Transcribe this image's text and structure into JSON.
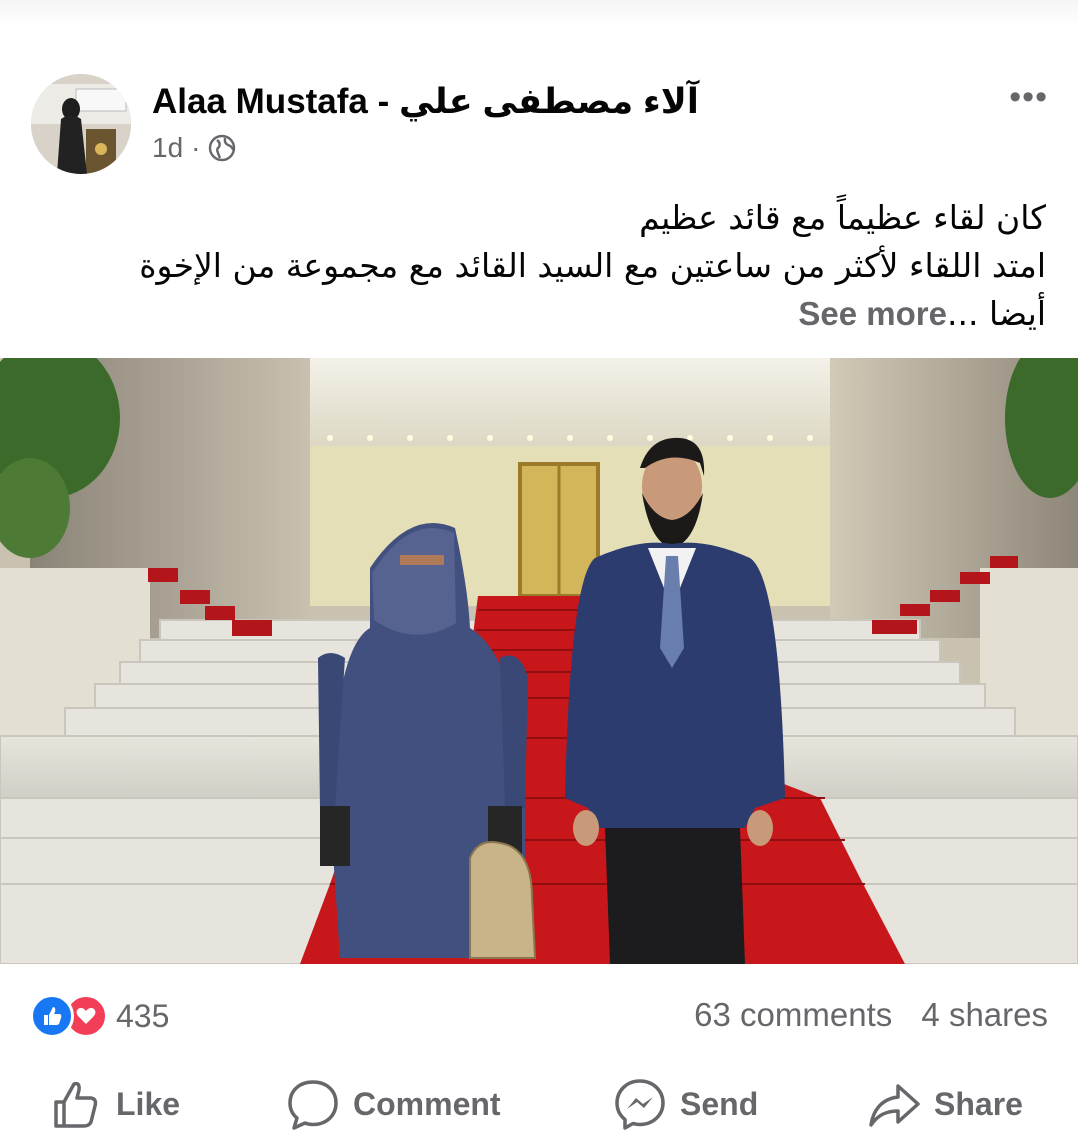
{
  "post": {
    "author": "Alaa Mustafa - آلاء مصطفى علي",
    "time": "1d",
    "privacy_icon": "globe-icon",
    "more_label": "•••",
    "text_lines": [
      "كان لقاء عظيماً مع قائد عظيم",
      "امتد اللقاء لأكثر من ساعتين مع السيد القائد مع مجموعة من الإخوة",
      "أيضا ..."
    ],
    "see_more": "See more"
  },
  "stats": {
    "reaction_icons": [
      "like-icon",
      "love-icon"
    ],
    "reactions_count": "435",
    "comments": "63 comments",
    "shares": "4 shares"
  },
  "actions": [
    {
      "label": "Like",
      "icon": "thumbs-up-icon"
    },
    {
      "label": "Comment",
      "icon": "comment-bubble-icon"
    },
    {
      "label": "Send",
      "icon": "messenger-icon"
    },
    {
      "label": "Share",
      "icon": "share-arrow-icon"
    }
  ],
  "colors": {
    "like_blue": "#1877f2",
    "love_red": "#f33e58",
    "secondary_text": "#65676b",
    "carpet_red": "#c8171a"
  }
}
